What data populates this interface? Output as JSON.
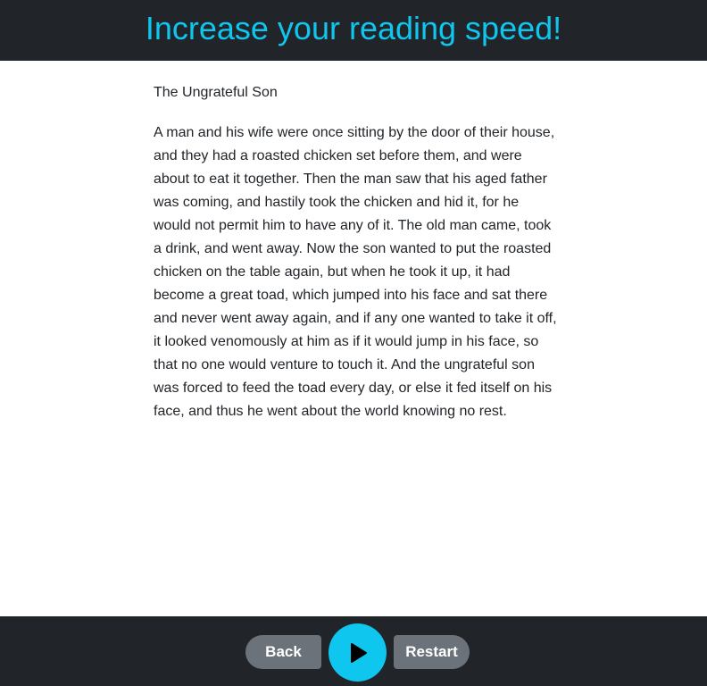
{
  "header": {
    "title": "Increase your reading speed!"
  },
  "story": {
    "title": "The Ungrateful Son",
    "lines": [
      "A man and his wife were once sitting by the door of their house,",
      "and they had a roasted chicken set before them, and were",
      "about to eat it together. Then the man saw that his aged father",
      "was coming, and hastily took the chicken and hid it, for he",
      "would not permit him to have any of it. The old man came, took",
      "a drink, and went away. Now the son wanted to put the roasted",
      "chicken on the table again, but when he took it up, it had",
      "become a great toad, which jumped into his face and sat there",
      "and never went away again, and if any one wanted to take it off,",
      "it looked venomously at him as if it would jump in his face, so",
      "that no one would venture to touch it. And the ungrateful son",
      "was forced to feed the toad every day, or else it fed itself on his",
      "face, and thus he went about the world knowing no rest."
    ]
  },
  "controls": {
    "back_label": "Back",
    "play_icon": "play-icon",
    "restart_label": "Restart"
  },
  "colors": {
    "accent": "#0fc6ef",
    "bar": "#212429",
    "button": "#6c727a"
  }
}
